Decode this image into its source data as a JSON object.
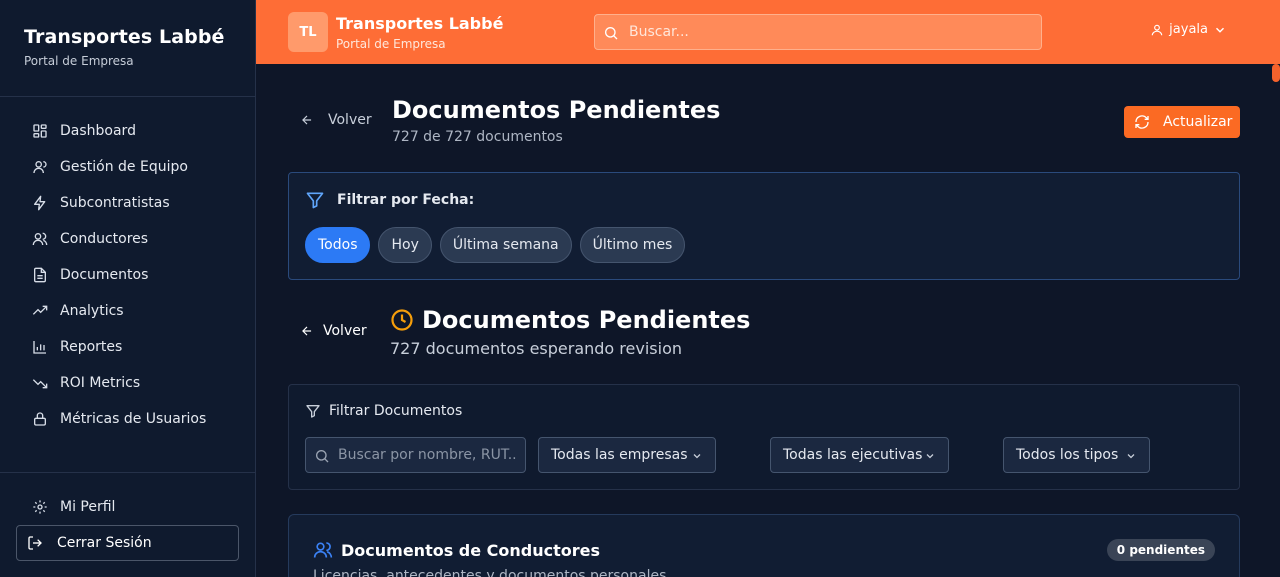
{
  "sidebar": {
    "brand_title": "Transportes Labbé",
    "brand_subtitle": "Portal de Empresa",
    "items": [
      {
        "label": "Dashboard",
        "icon": "dashboard-icon"
      },
      {
        "label": "Gestión de Equipo",
        "icon": "user-icon"
      },
      {
        "label": "Subcontratistas",
        "icon": "bolt-icon"
      },
      {
        "label": "Conductores",
        "icon": "users-icon"
      },
      {
        "label": "Documentos",
        "icon": "document-icon"
      },
      {
        "label": "Analytics",
        "icon": "trending-up-icon"
      },
      {
        "label": "Reportes",
        "icon": "bar-chart-icon"
      },
      {
        "label": "ROI Metrics",
        "icon": "trending-down-icon"
      },
      {
        "label": "Métricas de Usuarios",
        "icon": "lock-icon"
      }
    ],
    "profile_label": "Mi Perfil",
    "logout_label": "Cerrar Sesión"
  },
  "header": {
    "logo_initials": "TL",
    "title": "Transportes Labbé",
    "subtitle": "Portal de Empresa",
    "search_placeholder": "Buscar...",
    "username": "jayala"
  },
  "page": {
    "back_label": "Volver",
    "title": "Documentos Pendientes",
    "count_text": "727 de 727 documentos",
    "refresh_label": "Actualizar"
  },
  "date_filter": {
    "heading": "Filtrar por Fecha:",
    "options": [
      "Todos",
      "Hoy",
      "Última semana",
      "Último mes"
    ],
    "selected": "Todos"
  },
  "pending": {
    "back_label": "Volver",
    "title": "Documentos Pendientes",
    "subtitle": "727 documentos esperando revision"
  },
  "doc_filter": {
    "heading": "Filtrar Documentos",
    "search_placeholder": "Buscar por nombre, RUT...",
    "company_select": "Todas las empresas",
    "executive_select": "Todas las ejecutivas",
    "type_select": "Todos los tipos"
  },
  "drivers_docs": {
    "title": "Documentos de Conductores",
    "badge": "0 pendientes",
    "subtitle": "Licencias, antecedentes y documentos personales"
  },
  "colors": {
    "header_bg": "#fe6d36",
    "accent_orange": "#fb6a23",
    "active_chip": "#2c7af5",
    "page_bg": "#0e1628"
  }
}
